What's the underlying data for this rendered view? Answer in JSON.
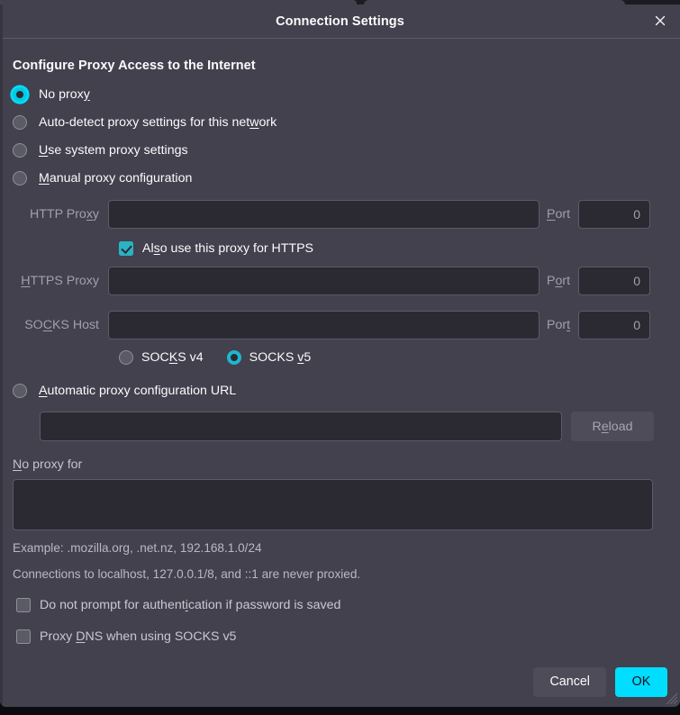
{
  "window": {
    "title": "Connection Settings",
    "close_icon": "close-icon"
  },
  "section": {
    "heading": "Configure Proxy Access to the Internet"
  },
  "proxy_mode": {
    "selected": "no_proxy",
    "options": [
      {
        "id": "no_proxy",
        "label_before": "No prox",
        "accel": "y",
        "label_after": "",
        "checked": true,
        "focused": true
      },
      {
        "id": "auto_detect",
        "label_before": "Auto-detect proxy settings for this net",
        "accel": "w",
        "label_after": "ork",
        "checked": false,
        "focused": false
      },
      {
        "id": "system",
        "label_before": "",
        "accel": "U",
        "label_after": "se system proxy settings",
        "checked": false,
        "focused": false
      },
      {
        "id": "manual",
        "label_before": "",
        "accel": "M",
        "label_after": "anual proxy configuration",
        "checked": false,
        "focused": false
      }
    ]
  },
  "manual": {
    "http": {
      "label_before": "HTTP Pro",
      "accel": "x",
      "label_after": "y",
      "value": "",
      "placeholder": "",
      "port_label_before": "",
      "port_accel": "P",
      "port_label_after": "ort",
      "port_value": "0"
    },
    "also_https": {
      "label_before": "Al",
      "accel": "s",
      "label_after": "o use this proxy for HTTPS",
      "checked": true
    },
    "https": {
      "label_before": "",
      "accel": "H",
      "label_after": "TTPS Proxy",
      "value": "",
      "placeholder": "",
      "port_label_before": "P",
      "port_accel": "o",
      "port_label_after": "rt",
      "port_value": "0"
    },
    "socks": {
      "label_before": "SO",
      "accel": "C",
      "label_after": "KS Host",
      "value": "",
      "placeholder": "",
      "port_label_before": "Por",
      "port_accel": "t",
      "port_label_after": "",
      "port_value": "0"
    },
    "socks_version": {
      "selected": "v5",
      "v4": {
        "label_before": "SOC",
        "accel": "K",
        "label_after": "S v4",
        "checked": false
      },
      "v5": {
        "label_before": "SOCKS ",
        "accel": "v",
        "label_after": "5",
        "checked": true
      }
    }
  },
  "auto_config": {
    "radio": {
      "label_before": "",
      "accel": "A",
      "label_after": "utomatic proxy configuration URL",
      "checked": false
    },
    "url_value": "",
    "url_placeholder": "",
    "reload": {
      "label_before": "R",
      "accel": "e",
      "label_after": "load"
    }
  },
  "no_proxy_for": {
    "label_before": "",
    "accel": "N",
    "label_after": "o proxy for",
    "value": "",
    "placeholder": ""
  },
  "hints": {
    "example": "Example: .mozilla.org, .net.nz, 192.168.1.0/24",
    "localhost": "Connections to localhost, 127.0.0.1/8, and ::1 are never proxied."
  },
  "bottom_checks": [
    {
      "id": "no_prompt_auth",
      "label_before": "Do not prompt for authent",
      "accel": "i",
      "label_after": "cation if password is saved",
      "checked": false
    },
    {
      "id": "proxy_dns",
      "label_before": "Proxy ",
      "accel": "D",
      "label_after": "NS when using SOCKS v5",
      "checked": false
    }
  ],
  "footer": {
    "cancel_label": "Cancel",
    "ok_label": "OK"
  },
  "colors": {
    "accent": "#00ddff",
    "radio_accent": "#00c8de",
    "checkbox_accent": "#2ab3c4",
    "dialog_bg": "#42414d",
    "input_bg": "#2b2a33",
    "text": "#fbfbfe"
  }
}
